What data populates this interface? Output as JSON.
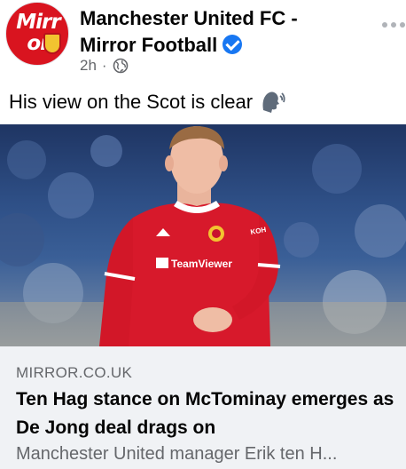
{
  "post": {
    "page_name_line1": "Manchester United FC -",
    "page_name_line2": "Mirror Football",
    "time": "2h",
    "separator": "·",
    "caption": "His view on the Scot is clear"
  },
  "avatar": {
    "text_line1": "Mirr",
    "text_line2": "or"
  },
  "link": {
    "domain": "MIRROR.CO.UK",
    "title": "Ten Hag stance on McTominay emerges as De Jong deal drags on",
    "description": "Manchester United manager Erik ten H..."
  },
  "shirt": {
    "sponsor": "TeamViewer",
    "brand": "KOH"
  },
  "icons": {
    "verified": "verified-badge-icon",
    "audience": "globe-icon",
    "caption_emoji": "speaking-head-icon",
    "more": "more-options-icon"
  },
  "colors": {
    "verified_blue": "#1877f2",
    "mirror_red": "#d9141f",
    "shirt_red": "#d7192b",
    "preview_bg": "#f0f2f5",
    "secondary_text": "#65676b"
  }
}
